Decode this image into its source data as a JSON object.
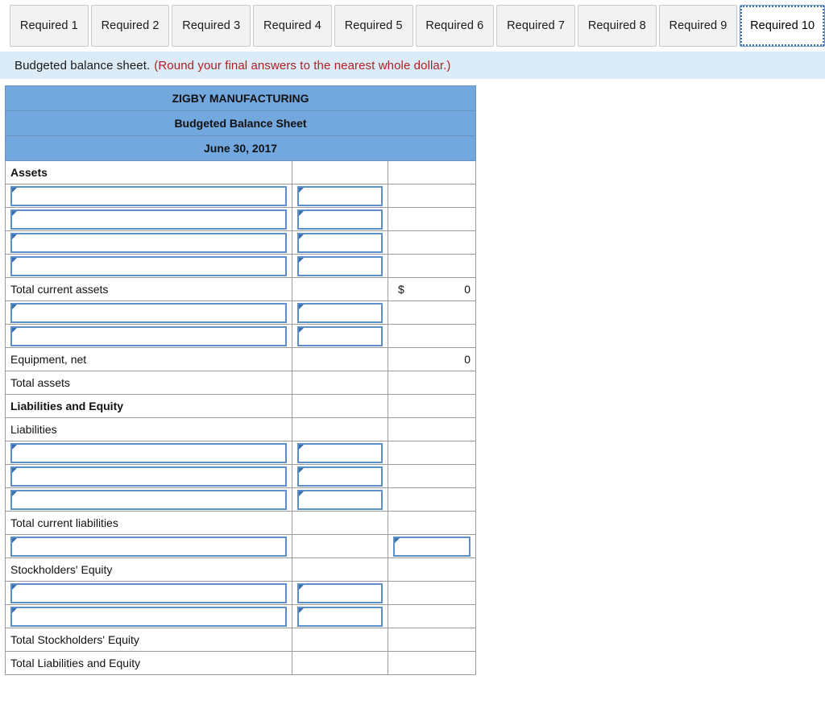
{
  "tabs": [
    {
      "label": "Required 1",
      "active": false
    },
    {
      "label": "Required 2",
      "active": false
    },
    {
      "label": "Required 3",
      "active": false
    },
    {
      "label": "Required 4",
      "active": false
    },
    {
      "label": "Required 5",
      "active": false
    },
    {
      "label": "Required 6",
      "active": false
    },
    {
      "label": "Required 7",
      "active": false
    },
    {
      "label": "Required 8",
      "active": false
    },
    {
      "label": "Required 9",
      "active": false
    },
    {
      "label": "Required 10",
      "active": true
    }
  ],
  "instruction": {
    "text": "Budgeted balance sheet.",
    "note": "(Round your final answers to the nearest whole dollar.)",
    "note_color": "#b02020",
    "background": "#dbebf7"
  },
  "statement": {
    "company": "ZIGBY MANUFACTURING",
    "title": "Budgeted Balance Sheet",
    "date": "June 30, 2017",
    "header_background": "#72a8de"
  },
  "rows": [
    {
      "id": "assets-header",
      "label": "Assets",
      "style": "section"
    },
    {
      "id": "asset-item-1",
      "label": "",
      "style": "input-pair"
    },
    {
      "id": "asset-item-2",
      "label": "",
      "style": "input-pair"
    },
    {
      "id": "asset-item-3",
      "label": "",
      "style": "input-pair"
    },
    {
      "id": "asset-item-4",
      "label": "",
      "style": "input-pair-last"
    },
    {
      "id": "total-current-assets",
      "label": "Total current assets",
      "style": "total-money",
      "dollar": "$",
      "value": "0"
    },
    {
      "id": "asset-item-5",
      "label": "",
      "style": "input-pair"
    },
    {
      "id": "asset-item-6",
      "label": "",
      "style": "input-pair-last"
    },
    {
      "id": "equipment-net",
      "label": "Equipment, net",
      "style": "total-value",
      "value": "0"
    },
    {
      "id": "total-assets",
      "label": "Total assets",
      "style": "grand-total",
      "value": ""
    },
    {
      "id": "liabilities-equity-header",
      "label": "Liabilities and Equity",
      "style": "section"
    },
    {
      "id": "liabilities-header",
      "label": "Liabilities",
      "style": "label"
    },
    {
      "id": "liability-item-1",
      "label": "",
      "style": "input-pair"
    },
    {
      "id": "liability-item-2",
      "label": "",
      "style": "input-pair"
    },
    {
      "id": "liability-item-3",
      "label": "",
      "style": "input-pair-last"
    },
    {
      "id": "total-current-liabilities",
      "label": "Total current liabilities",
      "style": "label"
    },
    {
      "id": "liability-item-4",
      "label": "",
      "style": "input-col1-col3"
    },
    {
      "id": "stockholders-equity-header",
      "label": "Stockholders' Equity",
      "style": "label"
    },
    {
      "id": "equity-item-1",
      "label": "",
      "style": "input-pair"
    },
    {
      "id": "equity-item-2",
      "label": "",
      "style": "input-pair-last"
    },
    {
      "id": "total-stockholders-equity",
      "label": "Total Stockholders' Equity",
      "style": "label"
    },
    {
      "id": "total-liabilities-equity",
      "label": "Total Liabilities and Equity",
      "style": "grand-total",
      "value": ""
    }
  ]
}
